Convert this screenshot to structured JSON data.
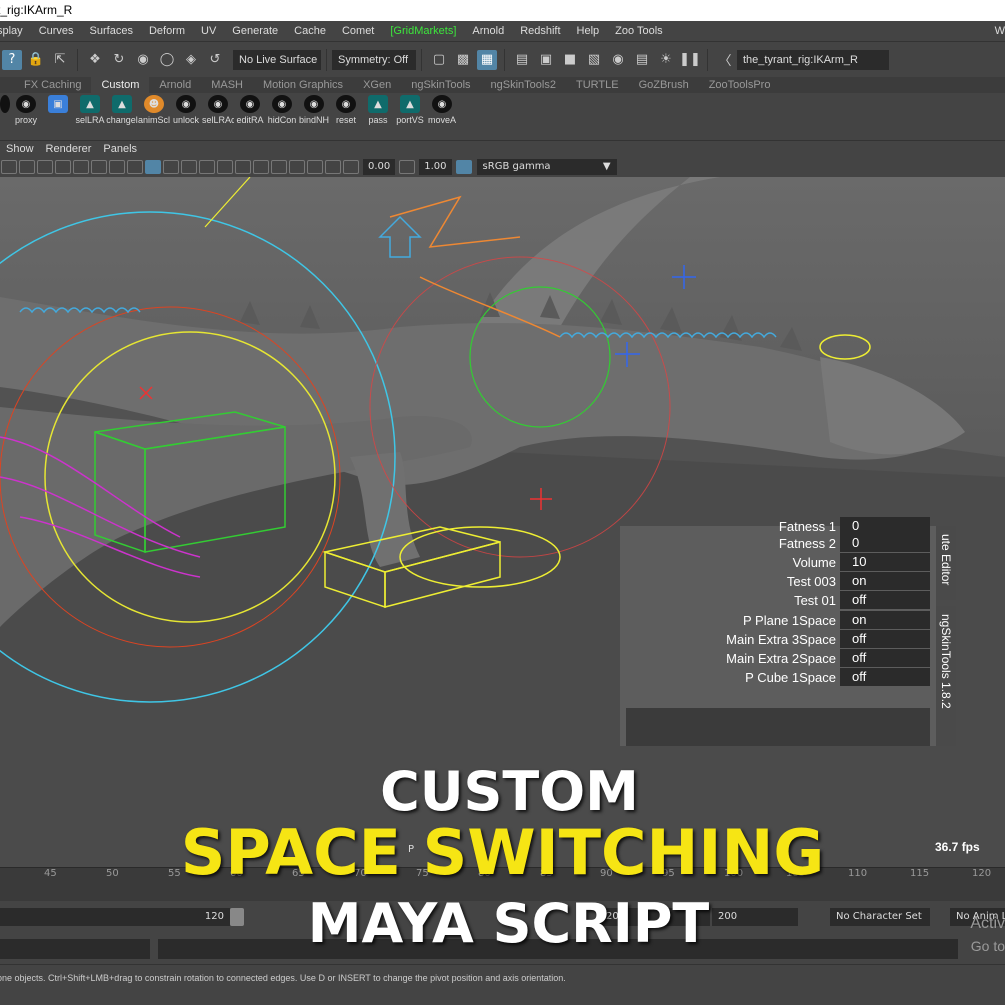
{
  "window": {
    "title": "t_rig:IKArm_R"
  },
  "menubar": {
    "items": [
      "splay",
      "Curves",
      "Surfaces",
      "Deform",
      "UV",
      "Generate",
      "Cache",
      "Comet",
      "[GridMarkets]",
      "Arnold",
      "Redshift",
      "Help",
      "Zoo Tools"
    ],
    "right_fragment": "W"
  },
  "statusline": {
    "live_surface": "No Live Surface",
    "symmetry": "Symmetry: Off",
    "object_field": "the_tyrant_rig:IKArm_R"
  },
  "shelf_tabs": {
    "items": [
      "FX Caching",
      "Custom",
      "Arnold",
      "MASH",
      "Motion Graphics",
      "XGen",
      "ngSkinTools",
      "ngSkinTools2",
      "TURTLE",
      "GoZBrush",
      "ZooToolsPro"
    ],
    "active": "Custom"
  },
  "shelf": {
    "buttons": [
      "proxy",
      "changel",
      "animScl",
      "unlock",
      "selLRA",
      "selLRAc",
      "editRA",
      "hidCon",
      "bindNH",
      "reset",
      "pass",
      "portVS",
      "moveA"
    ]
  },
  "panel_menu": {
    "items": [
      "Show",
      "Renderer",
      "Panels"
    ]
  },
  "panel_toolbar": {
    "exposure": "0.00",
    "gamma_value": "1.00",
    "color_space": "sRGB gamma"
  },
  "viewport": {
    "fps": "36.7 fps",
    "camera_fragment": "P"
  },
  "attributes": {
    "rows": [
      {
        "label": "Fatness 1",
        "value": "0"
      },
      {
        "label": "Fatness 2",
        "value": "0"
      },
      {
        "label": "Volume",
        "value": "10"
      },
      {
        "label": "Test 003",
        "value": "on"
      },
      {
        "label": "Test 01",
        "value": "off"
      },
      {
        "label": "P Plane 1Space",
        "value": "on"
      },
      {
        "label": "Main Extra 3Space",
        "value": "off"
      },
      {
        "label": "Main Extra 2Space",
        "value": "off"
      },
      {
        "label": "P Cube 1Space",
        "value": "off"
      }
    ],
    "tab_attribute_editor": "ute Editor",
    "tab_ngskin": "ngSkinTools 1.8.2"
  },
  "timeline": {
    "ticks": [
      "45",
      "50",
      "55",
      "60",
      "65",
      "70",
      "75",
      "80",
      "85",
      "90",
      "95",
      "100",
      "105",
      "110",
      "115",
      "120"
    ]
  },
  "range": {
    "end_inner": "120",
    "start_outer": "20",
    "end_outer": "200",
    "character_set": "No Character Set",
    "anim_layer": "No Anim L"
  },
  "watermark": {
    "line1": "Activ",
    "line2": "Go to"
  },
  "helpline": {
    "text": "one objects. Ctrl+Shift+LMB+drag to constrain rotation to connected edges. Use D or INSERT to change the pivot position and axis orientation."
  },
  "overlay": {
    "line1": "CUSTOM",
    "line2": "SPACE SWITCHING",
    "line3": "MAYA SCRIPT"
  },
  "colors": {
    "highlight": "#5285a6",
    "gridmarkets": "#3ce63c",
    "overlay_yellow": "#f6e514"
  }
}
